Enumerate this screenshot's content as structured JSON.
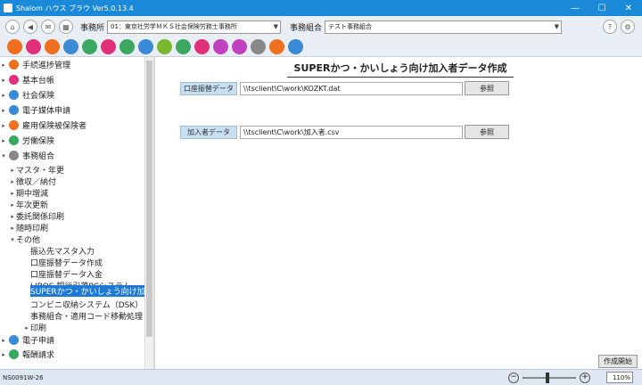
{
  "window": {
    "title": "Shalom ハウス ブラウ Ver5.0.13.4",
    "minimize": "—",
    "maximize": "☐",
    "close": "✕"
  },
  "header": {
    "office_label": "事務所",
    "office_value": "01：東京社労学ＭＫＳ社会保険労務士事務所",
    "union_label": "事務組合",
    "union_value": "テスト事務組合"
  },
  "toolbar_icons": [
    {
      "name": "progress-icon",
      "color": "#f07020"
    },
    {
      "name": "ledger-icon",
      "color": "#e0307a"
    },
    {
      "name": "company-icon",
      "color": "#f07020"
    },
    {
      "name": "social-insurance-icon",
      "color": "#3a8ad8"
    },
    {
      "name": "electronic-filing-icon",
      "color": "#3aa860"
    },
    {
      "name": "employment-insurance-icon",
      "color": "#e0307a"
    },
    {
      "name": "labor-insurance-icon",
      "color": "#3aa860"
    },
    {
      "name": "union-icon",
      "color": "#3a8ad8"
    },
    {
      "name": "calc-icon",
      "color": "#7ab830"
    },
    {
      "name": "doc-icon",
      "color": "#3aa860"
    },
    {
      "name": "report-icon",
      "color": "#e0307a"
    },
    {
      "name": "tag-icon",
      "color": "#c040c0"
    },
    {
      "name": "card-icon",
      "color": "#c040c0"
    },
    {
      "name": "camera-icon",
      "color": "#888888"
    },
    {
      "name": "home-icon",
      "color": "#f07020"
    },
    {
      "name": "document-icon",
      "color": "#3a8ad8"
    }
  ],
  "tree": {
    "progress": "手続進捗管理",
    "ledger": "基本台帳",
    "social": "社会保険",
    "efiling": "電子媒体申請",
    "employment": "雇用保険被保険者",
    "labor": "労働保険",
    "union": "事務組合",
    "master": "マスタ・年更",
    "collect": "徴収／納付",
    "midterm": "期中増減",
    "annual": "年次更新",
    "printing": "委託関係印刷",
    "adhoc": "随時印刷",
    "other": "その他",
    "leaves": [
      "振込先マスタ入力",
      "口座振替データ作成",
      "口座振替データ入金",
      "LIBOS 銀行引落PCシステム",
      "SUPERかつ・かいしょう向け加入者",
      "コンビニ収納システム（DSK）",
      "事務組合・適用コード移動処理"
    ],
    "print": "印刷",
    "echallenge": "電子申請",
    "billing": "報酬請求"
  },
  "main": {
    "title": "SUPERかつ・かいしょう向け加入者データ作成",
    "field1_label": "口座振替データ",
    "field1_value": "\\\\tsclient\\C\\work\\KOZKT.dat",
    "field2_label": "加入者データ",
    "field2_value": "\\\\tsclient\\C\\work\\加入者.csv",
    "browse": "参照",
    "create": "作成開始"
  },
  "status": {
    "text": "NS0091W-26",
    "zoom": "110%",
    "minus": "−",
    "plus": "+"
  },
  "colors": {
    "titlebar": "#1a8ad8",
    "selected": "#1e7ad6"
  }
}
